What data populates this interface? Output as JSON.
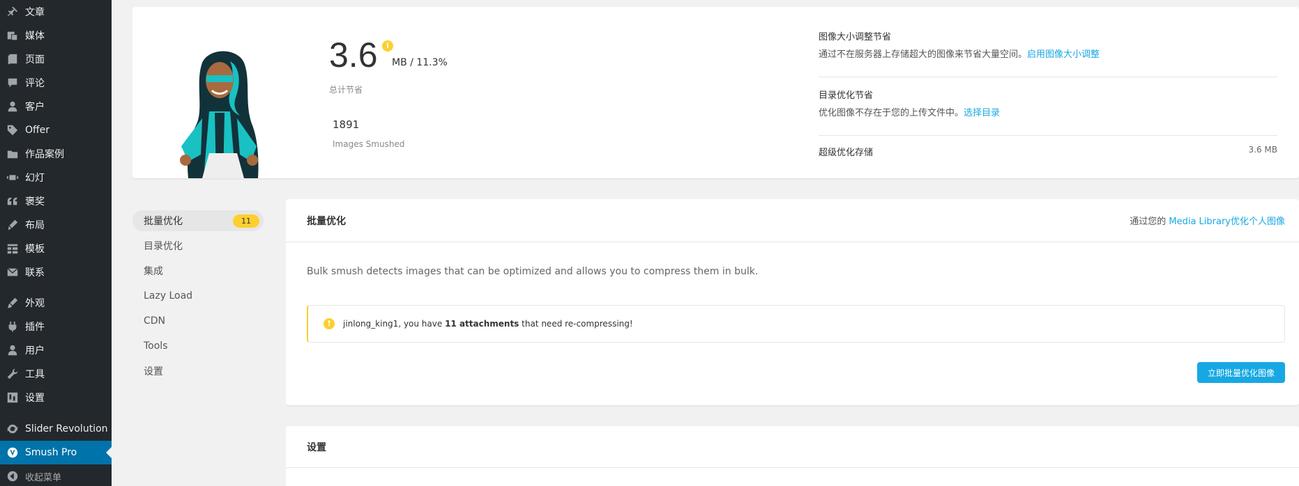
{
  "sidebar": {
    "items": [
      {
        "label": "文章",
        "icon": "pin-icon"
      },
      {
        "label": "媒体",
        "icon": "media-icon"
      },
      {
        "label": "页面",
        "icon": "page-icon"
      },
      {
        "label": "评论",
        "icon": "comment-icon"
      },
      {
        "label": "客户",
        "icon": "user-icon"
      },
      {
        "label": "Offer",
        "icon": "tag-icon"
      },
      {
        "label": "作品案例",
        "icon": "folder-icon"
      },
      {
        "label": "幻灯",
        "icon": "slides-icon"
      },
      {
        "label": "褒奖",
        "icon": "quote-icon"
      },
      {
        "label": "布局",
        "icon": "brush-icon"
      },
      {
        "label": "模板",
        "icon": "grid-icon"
      },
      {
        "label": "联系",
        "icon": "mail-icon"
      },
      {
        "label": "外观",
        "icon": "appearance-icon"
      },
      {
        "label": "插件",
        "icon": "plugin-icon"
      },
      {
        "label": "用户",
        "icon": "users-icon"
      },
      {
        "label": "工具",
        "icon": "wrench-icon"
      },
      {
        "label": "设置",
        "icon": "settings-icon"
      },
      {
        "label": "Slider Revolution",
        "icon": "refresh-icon"
      },
      {
        "label": "Smush Pro",
        "icon": "smush-icon"
      },
      {
        "label": "收起菜单",
        "icon": "collapse-icon"
      }
    ]
  },
  "stats": {
    "total_savings": "3.6",
    "savings_unit": "MB / 11.3%",
    "total_label": "总计节省",
    "images_smushed": "1891",
    "images_smushed_label": "Images Smushed",
    "resize_title": "图像大小调整节省",
    "resize_desc": "通过不在服务器上存储超大的图像来节省大量空间。",
    "resize_link": "启用图像大小调整",
    "dir_title": "目录优化节省",
    "dir_desc": "优化图像不存在于您的上传文件中。",
    "dir_link": "选择目录",
    "super_label": "超级优化存储",
    "super_value": "3.6 MB"
  },
  "subnav": {
    "items": [
      {
        "label": "批量优化",
        "badge": "11"
      },
      {
        "label": "目录优化"
      },
      {
        "label": "集成"
      },
      {
        "label": "Lazy Load"
      },
      {
        "label": "CDN"
      },
      {
        "label": "Tools"
      },
      {
        "label": "设置"
      }
    ]
  },
  "bulk": {
    "title": "批量优化",
    "right_prefix": "通过您的 ",
    "right_link": "Media Library优化个人图像",
    "description": "Bulk smush detects images that can be optimized and allows you to compress them in bulk.",
    "notice_prefix": "jinlong_king1, you have ",
    "notice_bold": "11 attachments",
    "notice_suffix": " that need re-compressing!",
    "button": "立即批量优化图像"
  },
  "settings_card": {
    "title": "设置"
  },
  "colors": {
    "sidebar_bg": "#23282d",
    "active_blue": "#0073aa",
    "accent_blue": "#17a8e3",
    "warning_yellow": "#fecf2f"
  }
}
